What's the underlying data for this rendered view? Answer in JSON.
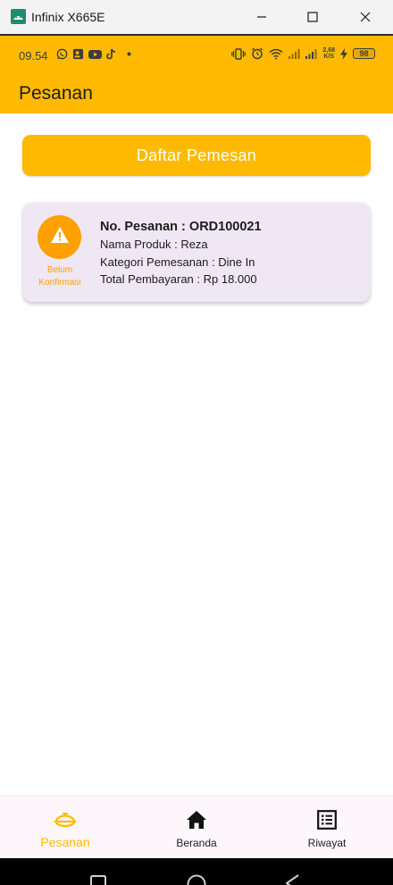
{
  "window": {
    "title": "Infinix X665E",
    "icon": "android-icon"
  },
  "status_bar": {
    "time": "09.54",
    "left_icons": [
      "whatsapp-icon",
      "contact-card-icon",
      "youtube-icon",
      "tiktok-icon",
      "dot-icon"
    ],
    "right_icons": [
      "vibrate-icon",
      "alarm-icon",
      "wifi-icon",
      "signal-icon-1",
      "signal-icon-2",
      "charging-icon"
    ],
    "net_speed_value": "2,68",
    "net_speed_unit": "K/S",
    "battery": "98"
  },
  "app_bar": {
    "title": "Pesanan"
  },
  "actions": {
    "daftar_pemesan_label": "Daftar Pemesan"
  },
  "orders": [
    {
      "status_icon": "warning-icon",
      "status_label": "Belum Konfirmasi",
      "order_no": "No. Pesanan : ORD100021",
      "product": "Nama Produk : Reza",
      "category": "Kategori Pemesanan : Dine In",
      "total": "Total Pembayaran : Rp 18.000"
    }
  ],
  "bottom_nav": {
    "items": [
      {
        "label": "Pesanan",
        "icon": "dish-cloche-icon",
        "active": true
      },
      {
        "label": "Beranda",
        "icon": "home-icon",
        "active": false
      },
      {
        "label": "Riwayat",
        "icon": "list-icon",
        "active": false
      }
    ]
  },
  "colors": {
    "primary": "#ffba00",
    "status_warning": "#ffa000",
    "card_background": "#efe8f4",
    "nav_background": "#fdf7fc"
  }
}
